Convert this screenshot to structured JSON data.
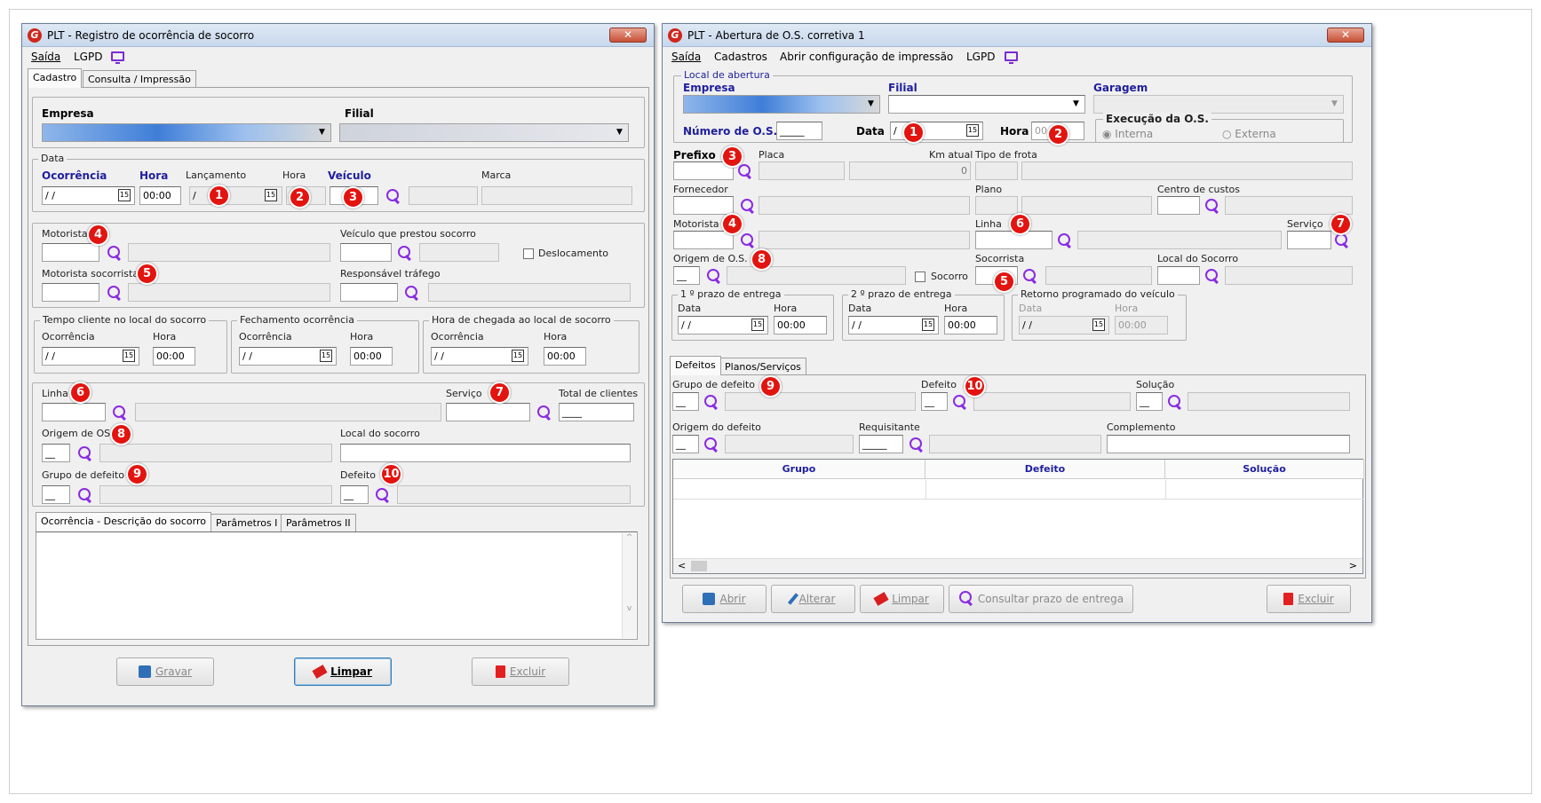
{
  "left_window": {
    "title": "PLT - Registro de ocorrência de socorro",
    "close": "✕",
    "menu": {
      "saida": "Saída",
      "lgpd": "LGPD"
    },
    "tabs": [
      "Cadastro",
      "Consulta / Impressão"
    ],
    "empresa_label": "Empresa",
    "filial_label": "Filial",
    "data_group": "Data",
    "ocorrencia_label": "Ocorrência",
    "hora_label": "Hora",
    "lancamento_label": "Lançamento",
    "hora2_label": "Hora",
    "veiculo_label": "Veículo",
    "marca_label": "Marca",
    "date_value": "/ /",
    "hora_value": "00:00",
    "lanc_value": "/",
    "cal": "15",
    "motorista_label": "Motorista",
    "veiculo_prestou_label": "Veículo que prestou socorro",
    "deslocamento_label": "Deslocamento",
    "motorista_socorrista_label": "Motorista socorrista",
    "responsavel_label": "Responsável tráfego",
    "tempo_group": "Tempo cliente no local do socorro",
    "fechamento_group": "Fechamento ocorrência",
    "chegada_group": "Hora de chegada ao local de socorro",
    "linha_label": "Linha",
    "servico_label": "Serviço",
    "total_clientes_label": "Total de clientes",
    "origem_label": "Origem de OS",
    "local_socorro_label": "Local do socorro",
    "grupo_defeito_label": "Grupo de defeito",
    "defeito_label": "Defeito",
    "subtabs": [
      "Ocorrência - Descrição do socorro",
      "Parâmetros I",
      "Parâmetros II"
    ],
    "buttons": {
      "gravar": "Gravar",
      "limpar": "Limpar",
      "excluir": "Excluir"
    }
  },
  "right_window": {
    "title": "PLT - Abertura de O.S. corretiva 1",
    "close": "✕",
    "menu": {
      "saida": "Saída",
      "cadastros": "Cadastros",
      "abrir_config": "Abrir configuração de impressão",
      "lgpd": "LGPD"
    },
    "local_group": "Local de abertura",
    "empresa_label": "Empresa",
    "filial_label": "Filial",
    "garagem_label": "Garagem",
    "numero_os_label": "Número de O.S.",
    "data_label": "Data",
    "hora_label": "Hora",
    "execucao_group": "Execução da O.S.",
    "interna_label": "Interna",
    "externa_label": "Externa",
    "prefixo_label": "Prefixo",
    "placa_label": "Placa",
    "km_label": "Km atual",
    "km_value": "0",
    "tipo_frota_label": "Tipo de frota",
    "fornecedor_label": "Fornecedor",
    "plano_label": "Plano",
    "centro_label": "Centro de custos",
    "motorista_label": "Motorista",
    "linha_label": "Linha",
    "servico_label": "Serviço",
    "origem_label": "Origem de O.S.",
    "socorro_label": "Socorro",
    "socorrista_label": "Socorrista",
    "local_socorro_label": "Local do Socorro",
    "prazo1_group": "1 º prazo de entrega",
    "prazo2_group": "2 º prazo de entrega",
    "retorno_group": "Retorno programado do veículo",
    "data_small": "Data",
    "hora_small": "Hora",
    "date_value": "/ /",
    "hora_value": "00:00",
    "cal": "15",
    "hora_ph": "00",
    "tabs": [
      "Defeitos",
      "Planos/Serviços"
    ],
    "grupo_defeito_label": "Grupo de defeito",
    "defeito_label": "Defeito",
    "solucao_label": "Solução",
    "origem_defeito_label": "Origem do defeito",
    "requisitante_label": "Requisitante",
    "complemento_label": "Complemento",
    "grid_headers": [
      "Grupo",
      "Defeito",
      "Solução"
    ],
    "buttons": {
      "abrir": "Abrir",
      "alterar": "Alterar",
      "limpar": "Limpar",
      "consultar": "Consultar prazo de entrega",
      "excluir": "Excluir"
    }
  },
  "badges": {
    "n1": "1",
    "n2": "2",
    "n3": "3",
    "n4": "4",
    "n5": "5",
    "n6": "6",
    "n7": "7",
    "n8": "8",
    "n9": "9",
    "n10": "10"
  },
  "colors": {
    "label_blue": "#1f1f9e",
    "search_icon": "#8a2be2",
    "badge_red": "#e3140f",
    "title_gradient": "#c8d8ec"
  }
}
